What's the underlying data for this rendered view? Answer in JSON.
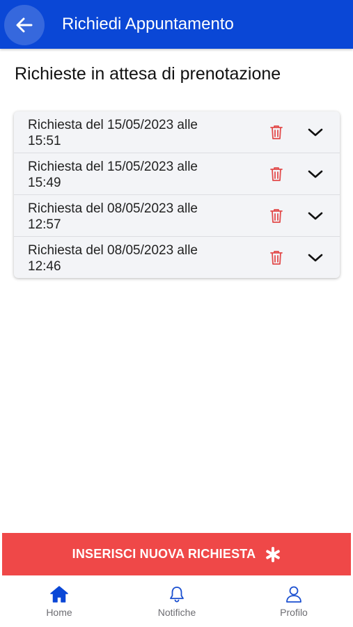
{
  "header": {
    "title": "Richiedi Appuntamento",
    "back_icon": "arrow-left-icon"
  },
  "section": {
    "title": "Richieste in attesa di prenotazione"
  },
  "requests": [
    {
      "label": "Richiesta del 15/05/2023 alle 15:51"
    },
    {
      "label": "Richiesta del 15/05/2023 alle 15:49"
    },
    {
      "label": "Richiesta del 08/05/2023 alle 12:57"
    },
    {
      "label": "Richiesta del 08/05/2023 alle 12:46"
    }
  ],
  "action": {
    "new_request_label": "INSERISCI NUOVA RICHIESTA",
    "icon": "asterisk-icon"
  },
  "tabbar": {
    "home": "Home",
    "notifiche": "Notifiche",
    "profilo": "Profilo",
    "active": "Home"
  },
  "colors": {
    "primary": "#0a47d6",
    "danger": "#ef4848",
    "trash": "#e24a4a",
    "tab_inactive": "#1a4fd0"
  }
}
